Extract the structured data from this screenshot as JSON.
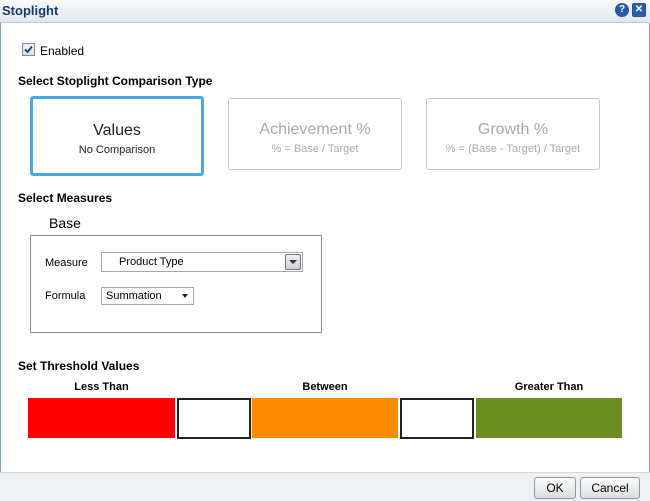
{
  "dialog": {
    "title": "Stoplight"
  },
  "titlebar": {
    "help_glyph": "?",
    "close_glyph": "✕"
  },
  "enabled": {
    "label": "Enabled",
    "checked": true
  },
  "comparison": {
    "heading": "Select Stoplight Comparison Type",
    "options": [
      {
        "title": "Values",
        "subtitle": "No Comparison",
        "selected": true
      },
      {
        "title": "Achievement %",
        "subtitle": "% = Base / Target",
        "selected": false
      },
      {
        "title": "Growth %",
        "subtitle": "% = (Base - Target) / Target",
        "selected": false
      }
    ]
  },
  "measures": {
    "heading": "Select Measures",
    "base_label": "Base",
    "measure_label": "Measure",
    "measure_value": "Product Type",
    "formula_label": "Formula",
    "formula_value": "Summation"
  },
  "thresholds": {
    "heading": "Set Threshold Values",
    "less_than_label": "Less Than",
    "between_label": "Between",
    "greater_than_label": "Greater Than",
    "lower_value": "",
    "upper_value": "",
    "colors": {
      "less_than": "#ff0000",
      "between": "#ff8c00",
      "greater_than": "#6b8e23"
    }
  },
  "footer": {
    "ok_label": "OK",
    "cancel_label": "Cancel"
  },
  "accent_color": "#4da7e6"
}
